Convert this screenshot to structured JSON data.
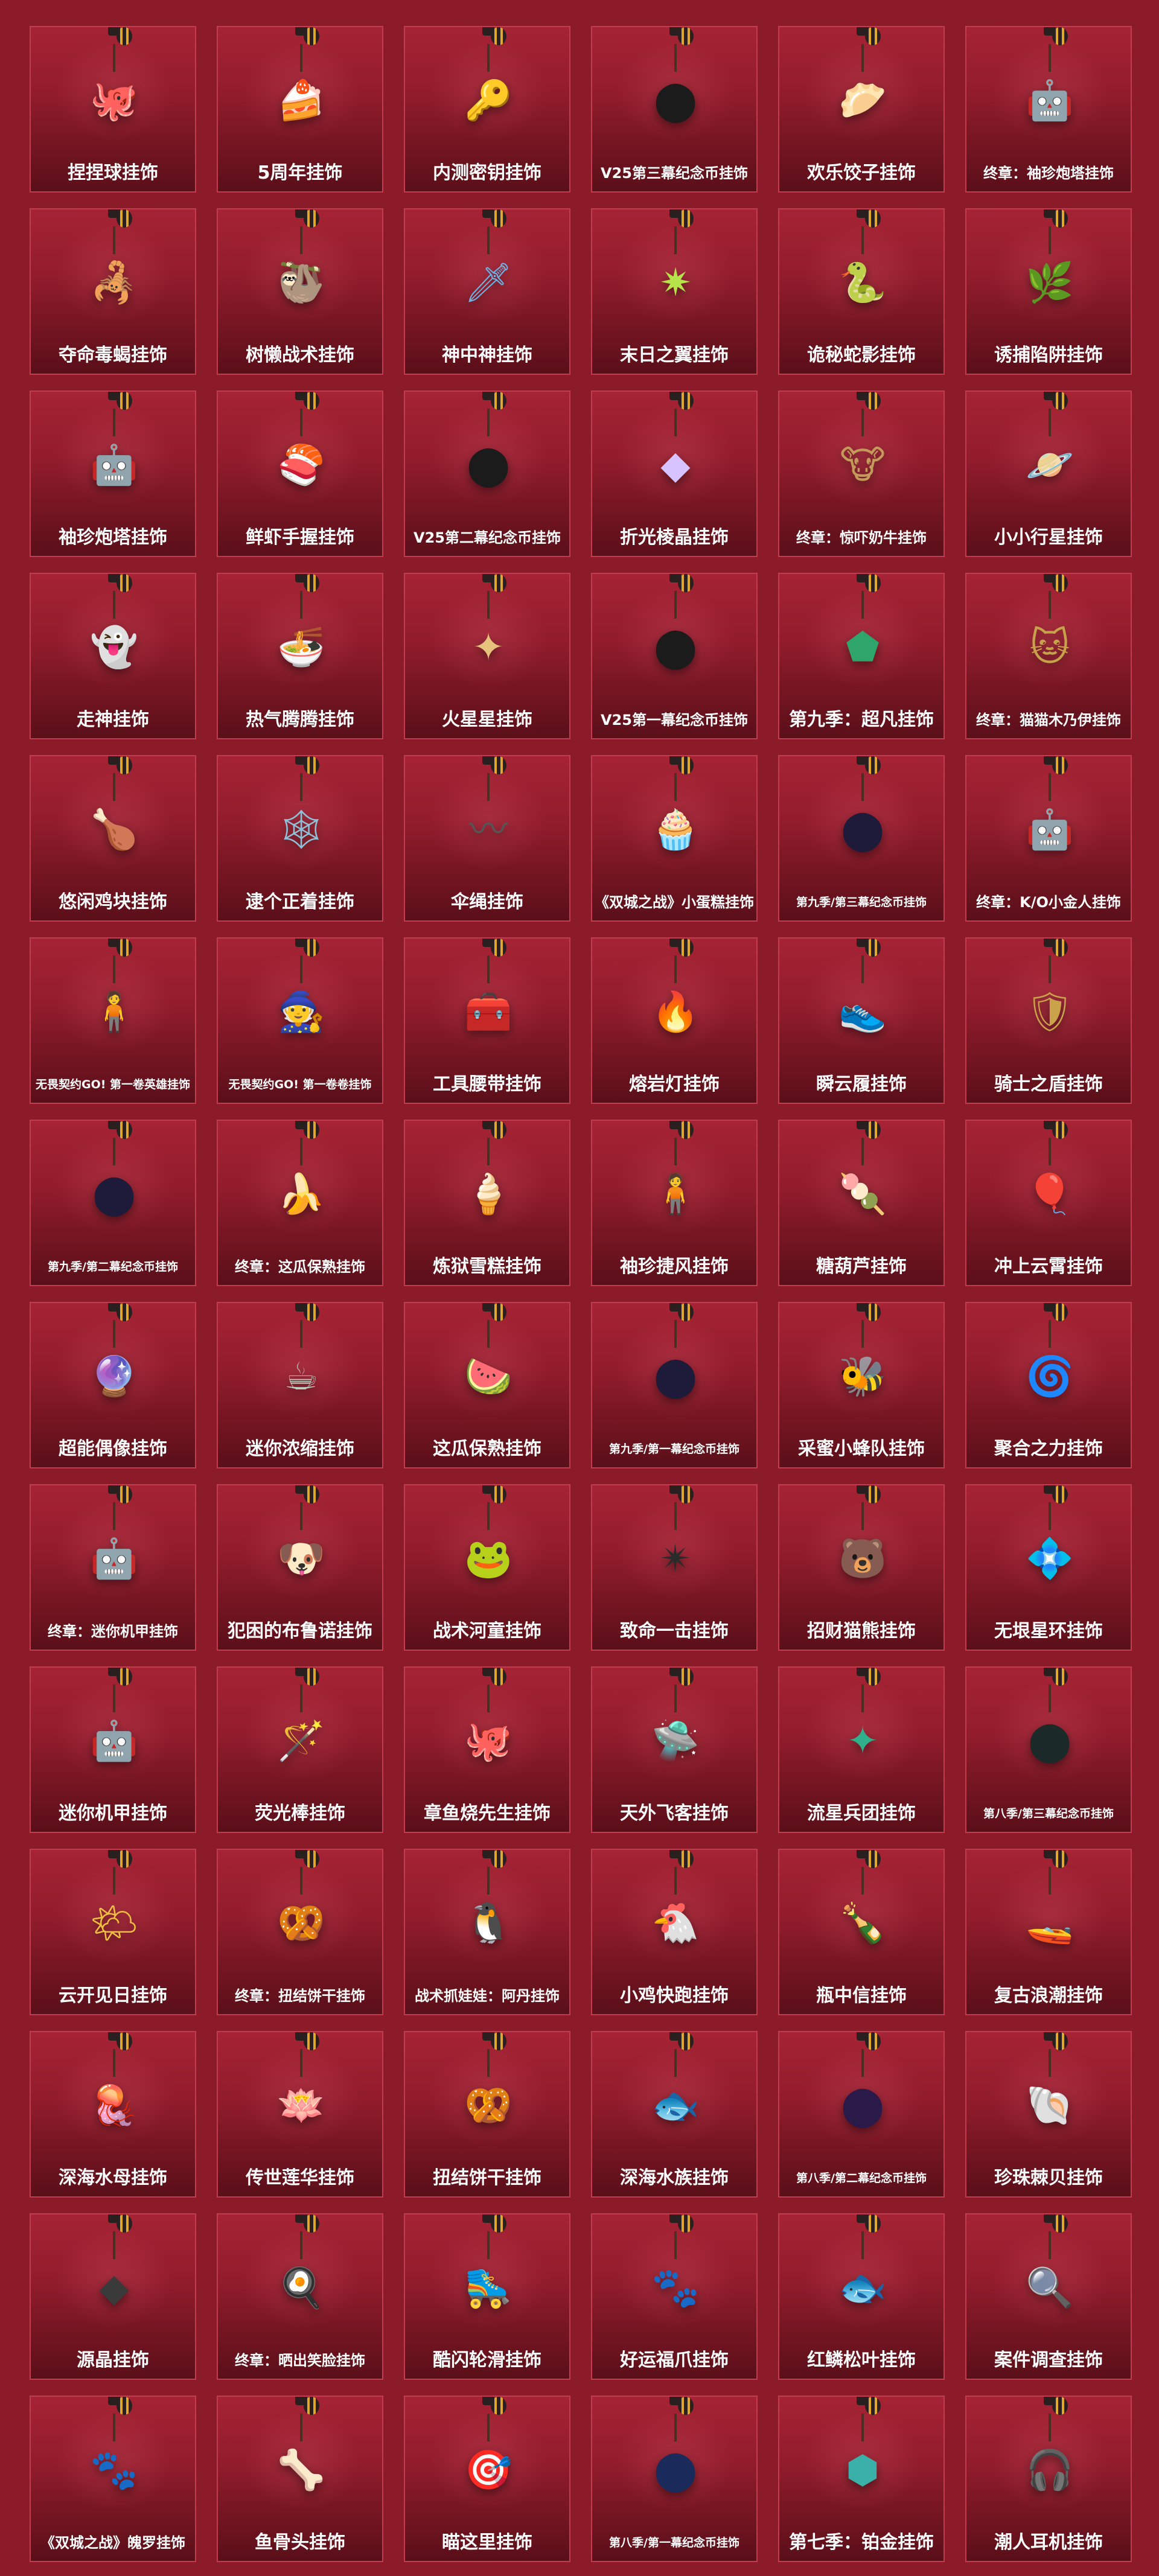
{
  "charms": [
    {
      "label": "捏捏球挂饰",
      "icon": "octopus-ball-charm-icon",
      "glyph": "🐙",
      "color": "#b98ad8"
    },
    {
      "label": "5周年挂饰",
      "icon": "cake-slice-charm-icon",
      "glyph": "🍰",
      "color": "#f1b08e"
    },
    {
      "label": "内测密钥挂饰",
      "icon": "key-charm-icon",
      "glyph": "🔑",
      "color": "#cfd6de"
    },
    {
      "label": "V25第三幕纪念币挂饰",
      "icon": "coin-charm-icon",
      "glyph": "⬤",
      "color": "#1b1b1b"
    },
    {
      "label": "欢乐饺子挂饰",
      "icon": "dumpling-charm-icon",
      "glyph": "🥟",
      "color": "#e7c9a8"
    },
    {
      "label": "终章：袖珍炮塔挂饰",
      "icon": "turret-charm-icon",
      "glyph": "🤖",
      "color": "#c9a238"
    },
    {
      "label": "夺命毒蝎挂饰",
      "icon": "scorpion-charm-icon",
      "glyph": "🦂",
      "color": "#7c3cd0"
    },
    {
      "label": "树懒战术挂饰",
      "icon": "sloth-charm-icon",
      "glyph": "🦥",
      "color": "#9b8b7a"
    },
    {
      "label": "神中神挂饰",
      "icon": "sword-charm-icon",
      "glyph": "🗡",
      "color": "#6fb2e6"
    },
    {
      "label": "末日之翼挂饰",
      "icon": "emblem-charm-icon",
      "glyph": "✷",
      "color": "#b7e34a"
    },
    {
      "label": "诡秘蛇影挂饰",
      "icon": "serpent-blade-charm-icon",
      "glyph": "🐍",
      "color": "#d94b56"
    },
    {
      "label": "诱捕陷阱挂饰",
      "icon": "trap-plant-charm-icon",
      "glyph": "🌿",
      "color": "#73b25a"
    },
    {
      "label": "袖珍炮塔挂饰",
      "icon": "turret-charm-icon",
      "glyph": "🤖",
      "color": "#c4c05a"
    },
    {
      "label": "鲜虾手握挂饰",
      "icon": "shrimp-sushi-charm-icon",
      "glyph": "🍣",
      "color": "#f08a66"
    },
    {
      "label": "V25第二幕纪念币挂饰",
      "icon": "coin-charm-icon",
      "glyph": "⬤",
      "color": "#1b1b1b"
    },
    {
      "label": "折光棱晶挂饰",
      "icon": "crystal-charm-icon",
      "glyph": "◆",
      "color": "#d7c3ff"
    },
    {
      "label": "终章：惊吓奶牛挂饰",
      "icon": "cow-charm-icon",
      "glyph": "🐮",
      "color": "#c39a5a"
    },
    {
      "label": "小小行星挂饰",
      "icon": "planet-charm-icon",
      "glyph": "🪐",
      "color": "#f0c070"
    },
    {
      "label": "走神挂饰",
      "icon": "ghost-charm-icon",
      "glyph": "👻",
      "color": "#f4d25a"
    },
    {
      "label": "热气腾腾挂饰",
      "icon": "bowl-charm-icon",
      "glyph": "🍜",
      "color": "#c8a26a"
    },
    {
      "label": "火星星挂饰",
      "icon": "star-charm-icon",
      "glyph": "✦",
      "color": "#e7c27d"
    },
    {
      "label": "V25第一幕纪念币挂饰",
      "icon": "coin-charm-icon",
      "glyph": "⬤",
      "color": "#1b1b1b"
    },
    {
      "label": "第九季：超凡挂饰",
      "icon": "gem-shield-charm-icon",
      "glyph": "⬟",
      "color": "#2fa56b"
    },
    {
      "label": "终章：猫猫木乃伊挂饰",
      "icon": "mummy-cat-charm-icon",
      "glyph": "🐱",
      "color": "#c8a24a"
    },
    {
      "label": "悠闲鸡块挂饰",
      "icon": "nugget-charm-icon",
      "glyph": "🍗",
      "color": "#d89a52"
    },
    {
      "label": "逮个正着挂饰",
      "icon": "net-charm-icon",
      "glyph": "🕸",
      "color": "#8fc1d8"
    },
    {
      "label": "伞绳挂饰",
      "icon": "paracord-charm-icon",
      "glyph": "〰",
      "color": "#555555"
    },
    {
      "label": "《双城之战》小蛋糕挂饰",
      "icon": "cupcake-charm-icon",
      "glyph": "🧁",
      "color": "#e98fb0"
    },
    {
      "label": "第九季/第三幕纪念币挂饰",
      "icon": "coin-charm-icon",
      "glyph": "⬤",
      "color": "#1e1b3a"
    },
    {
      "label": "终章：K/O小金人挂饰",
      "icon": "gold-robot-charm-icon",
      "glyph": "🤖",
      "color": "#d9a93a"
    },
    {
      "label": "无畏契约GO! 第一卷英雄挂饰",
      "icon": "agent-figure-charm-icon",
      "glyph": "🧍",
      "color": "#5a3a6a"
    },
    {
      "label": "无畏契约GO! 第一卷卷挂饰",
      "icon": "scarecrow-charm-icon",
      "glyph": "🧙",
      "color": "#8a7a5a"
    },
    {
      "label": "工具腰带挂饰",
      "icon": "tool-belt-charm-icon",
      "glyph": "🧰",
      "color": "#7a5a3a"
    },
    {
      "label": "熔岩灯挂饰",
      "icon": "lava-lamp-charm-icon",
      "glyph": "🔥",
      "color": "#b86cf0"
    },
    {
      "label": "瞬云履挂饰",
      "icon": "sneaker-charm-icon",
      "glyph": "👟",
      "color": "#2a2a2a"
    },
    {
      "label": "骑士之盾挂饰",
      "icon": "shield-charm-icon",
      "glyph": "🛡",
      "color": "#c9a24a"
    },
    {
      "label": "第九季/第二幕纪念币挂饰",
      "icon": "coin-charm-icon",
      "glyph": "⬤",
      "color": "#1e1b3a"
    },
    {
      "label": "终章：这瓜保熟挂饰",
      "icon": "melon-slice-charm-icon",
      "glyph": "🍌",
      "color": "#f0c84a"
    },
    {
      "label": "炼狱雪糕挂饰",
      "icon": "popsicle-charm-icon",
      "glyph": "🍦",
      "color": "#b0734a"
    },
    {
      "label": "袖珍捷风挂饰",
      "icon": "jett-figure-charm-icon",
      "glyph": "🧍",
      "color": "#c8d8e8"
    },
    {
      "label": "糖葫芦挂饰",
      "icon": "candied-haws-charm-icon",
      "glyph": "🍡",
      "color": "#e0452a"
    },
    {
      "label": "冲上云霄挂饰",
      "icon": "balloon-charm-icon",
      "glyph": "🎈",
      "color": "#e88a3a"
    },
    {
      "label": "超能偶像挂饰",
      "icon": "idol-orb-charm-icon",
      "glyph": "🔮",
      "color": "#d8b0f0"
    },
    {
      "label": "迷你浓缩挂饰",
      "icon": "espresso-machine-charm-icon",
      "glyph": "☕",
      "color": "#b8d0c0"
    },
    {
      "label": "这瓜保熟挂饰",
      "icon": "watermelon-charm-icon",
      "glyph": "🍉",
      "color": "#e0524a"
    },
    {
      "label": "第九季/第一幕纪念币挂饰",
      "icon": "coin-charm-icon",
      "glyph": "⬤",
      "color": "#1e1b3a"
    },
    {
      "label": "采蜜小蜂队挂饰",
      "icon": "beehive-charm-icon",
      "glyph": "🐝",
      "color": "#e0a83a"
    },
    {
      "label": "聚合之力挂饰",
      "icon": "swirl-charm-icon",
      "glyph": "🌀",
      "color": "#d8d8d8"
    },
    {
      "label": "终章：迷你机甲挂饰",
      "icon": "mecha-charm-icon",
      "glyph": "🤖",
      "color": "#e0b03a"
    },
    {
      "label": "犯困的布鲁诺挂饰",
      "icon": "bruno-dog-charm-icon",
      "glyph": "🐶",
      "color": "#d0a060"
    },
    {
      "label": "战术河童挂饰",
      "icon": "kappa-charm-icon",
      "glyph": "🐸",
      "color": "#6aa04a"
    },
    {
      "label": "致命一击挂饰",
      "icon": "shuriken-charm-icon",
      "glyph": "✴",
      "color": "#2a2a2a"
    },
    {
      "label": "招财猫熊挂饰",
      "icon": "panda-cat-charm-icon",
      "glyph": "🐻",
      "color": "#a07a6a"
    },
    {
      "label": "无垠星环挂饰",
      "icon": "ring-orb-charm-icon",
      "glyph": "💠",
      "color": "#3a8ae0"
    },
    {
      "label": "迷你机甲挂饰",
      "icon": "mecha-charm-icon",
      "glyph": "🤖",
      "color": "#5a6ad0"
    },
    {
      "label": "荧光棒挂饰",
      "icon": "glowstick-charm-icon",
      "glyph": "🪄",
      "color": "#6ae0f0"
    },
    {
      "label": "章鱼烧先生挂饰",
      "icon": "takoyaki-charm-icon",
      "glyph": "🐙",
      "color": "#c0603a"
    },
    {
      "label": "天外飞客挂饰",
      "icon": "ufo-charm-icon",
      "glyph": "🛸",
      "color": "#6a9ad8"
    },
    {
      "label": "流星兵团挂饰",
      "icon": "star-gem-charm-icon",
      "glyph": "✦",
      "color": "#2fb08a"
    },
    {
      "label": "第八季/第三幕纪念币挂饰",
      "icon": "coin-charm-icon",
      "glyph": "⬤",
      "color": "#1b2a28"
    },
    {
      "label": "云开见日挂饰",
      "icon": "sun-cloud-charm-icon",
      "glyph": "🌤",
      "color": "#f0c040"
    },
    {
      "label": "终章：扭结饼干挂饰",
      "icon": "pretzel-charm-icon",
      "glyph": "🥨",
      "color": "#d8a63a"
    },
    {
      "label": "战术抓娃娃：阿丹挂饰",
      "icon": "penguin-claw-charm-icon",
      "glyph": "🐧",
      "color": "#3a4a6a"
    },
    {
      "label": "小鸡快跑挂饰",
      "icon": "chicken-charm-icon",
      "glyph": "🐔",
      "color": "#e8e8e8"
    },
    {
      "label": "瓶中信挂饰",
      "icon": "bottle-charm-icon",
      "glyph": "🍾",
      "color": "#3a7a5a"
    },
    {
      "label": "复古浪潮挂饰",
      "icon": "jetski-charm-icon",
      "glyph": "🚤",
      "color": "#d04a8a"
    },
    {
      "label": "深海水母挂饰",
      "icon": "jellyfish-charm-icon",
      "glyph": "🪼",
      "color": "#c060e0"
    },
    {
      "label": "传世莲华挂饰",
      "icon": "lotus-charm-icon",
      "glyph": "🪷",
      "color": "#b070e0"
    },
    {
      "label": "扭结饼干挂饰",
      "icon": "pretzel-charm-icon",
      "glyph": "🥨",
      "color": "#c0703a"
    },
    {
      "label": "深海水族挂饰",
      "icon": "manta-ray-charm-icon",
      "glyph": "🐟",
      "color": "#3a9ad8"
    },
    {
      "label": "第八季/第二幕纪念币挂饰",
      "icon": "coin-charm-icon",
      "glyph": "⬤",
      "color": "#2a1a4a"
    },
    {
      "label": "珍珠棘贝挂饰",
      "icon": "shell-charm-icon",
      "glyph": "🐚",
      "color": "#d080c0"
    },
    {
      "label": "源晶挂饰",
      "icon": "source-crystal-charm-icon",
      "glyph": "◆",
      "color": "#3a3a3a"
    },
    {
      "label": "终章：晒出笑脸挂饰",
      "icon": "smile-pan-charm-icon",
      "glyph": "🍳",
      "color": "#e0b04a"
    },
    {
      "label": "酷闪轮滑挂饰",
      "icon": "roller-skate-charm-icon",
      "glyph": "🛼",
      "color": "#5a6aa0"
    },
    {
      "label": "好运福爪挂饰",
      "icon": "lucky-paw-charm-icon",
      "glyph": "🐾",
      "color": "#e07a2a"
    },
    {
      "label": "红鳞松叶挂饰",
      "icon": "koi-charm-icon",
      "glyph": "🐟",
      "color": "#d0b8b0"
    },
    {
      "label": "案件调查挂饰",
      "icon": "magnifier-charm-icon",
      "glyph": "🔍",
      "color": "#2a2a2a"
    },
    {
      "label": "《双城之战》魄罗挂饰",
      "icon": "poro-charm-icon",
      "glyph": "🐾",
      "color": "#8a8a9a"
    },
    {
      "label": "鱼骨头挂饰",
      "icon": "fishbone-charm-icon",
      "glyph": "🦴",
      "color": "#3a3a3a"
    },
    {
      "label": "瞄这里挂饰",
      "icon": "target-charm-icon",
      "glyph": "🎯",
      "color": "#a07060"
    },
    {
      "label": "第八季/第一幕纪念币挂饰",
      "icon": "coin-charm-icon",
      "glyph": "⬤",
      "color": "#1a2a5a"
    },
    {
      "label": "第七季：铂金挂饰",
      "icon": "platinum-badge-charm-icon",
      "glyph": "⬢",
      "color": "#3ab0a8"
    },
    {
      "label": "潮人耳机挂饰",
      "icon": "headphones-charm-icon",
      "glyph": "🎧",
      "color": "#7a4ad8"
    }
  ]
}
